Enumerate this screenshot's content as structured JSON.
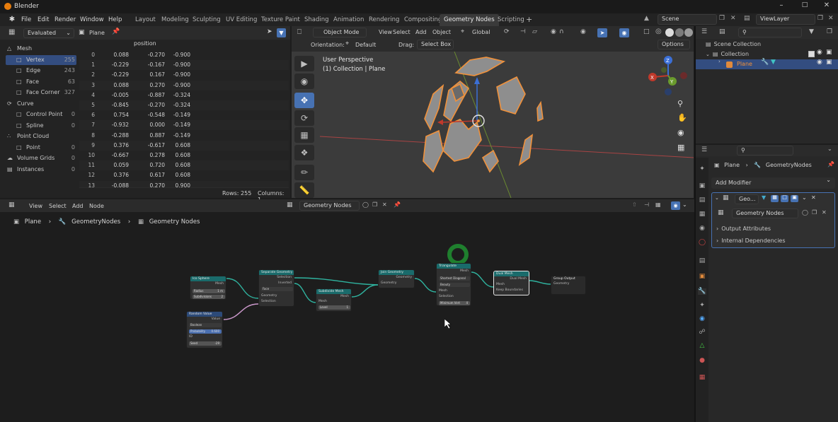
{
  "app": {
    "title": "Blender"
  },
  "menus": [
    "File",
    "Edit",
    "Render",
    "Window",
    "Help"
  ],
  "workspaces": [
    "Layout",
    "Modeling",
    "Sculpting",
    "UV Editing",
    "Texture Paint",
    "Shading",
    "Animation",
    "Rendering",
    "Compositing",
    "Geometry Nodes",
    "Scripting"
  ],
  "active_workspace": "Geometry Nodes",
  "scene": {
    "scene_name": "Scene",
    "view_layer": "ViewLayer"
  },
  "spreadsheet": {
    "mode": "Evaluated",
    "object": "Plane",
    "column_header": "position",
    "sidebar": [
      {
        "label": "Mesh",
        "count": "",
        "kind": "group"
      },
      {
        "label": "Vertex",
        "count": "255",
        "kind": "item",
        "active": true
      },
      {
        "label": "Edge",
        "count": "243",
        "kind": "item"
      },
      {
        "label": "Face",
        "count": "63",
        "kind": "item"
      },
      {
        "label": "Face Corner",
        "count": "327",
        "kind": "item"
      },
      {
        "label": "Curve",
        "count": "",
        "kind": "group"
      },
      {
        "label": "Control Point",
        "count": "0",
        "kind": "item"
      },
      {
        "label": "Spline",
        "count": "0",
        "kind": "item"
      },
      {
        "label": "Point Cloud",
        "count": "",
        "kind": "group"
      },
      {
        "label": "Point",
        "count": "0",
        "kind": "item"
      },
      {
        "label": "Volume Grids",
        "count": "0",
        "kind": "group"
      },
      {
        "label": "Instances",
        "count": "0",
        "kind": "group"
      }
    ],
    "rows": [
      [
        "0",
        "0.088",
        "-0.270",
        "-0.900"
      ],
      [
        "1",
        "-0.229",
        "-0.167",
        "-0.900"
      ],
      [
        "2",
        "-0.229",
        "0.167",
        "-0.900"
      ],
      [
        "3",
        "0.088",
        "0.270",
        "-0.900"
      ],
      [
        "4",
        "-0.005",
        "-0.887",
        "-0.324"
      ],
      [
        "5",
        "-0.845",
        "-0.270",
        "-0.324"
      ],
      [
        "6",
        "0.754",
        "-0.548",
        "-0.149"
      ],
      [
        "7",
        "-0.932",
        "0.000",
        "-0.149"
      ],
      [
        "8",
        "-0.288",
        "0.887",
        "-0.149"
      ],
      [
        "9",
        "0.376",
        "-0.617",
        "0.608"
      ],
      [
        "10",
        "-0.667",
        "0.278",
        "0.608"
      ],
      [
        "11",
        "0.059",
        "0.720",
        "0.608"
      ],
      [
        "12",
        "0.376",
        "0.617",
        "0.608"
      ],
      [
        "13",
        "-0.088",
        "0.270",
        "0.900"
      ]
    ],
    "footer": {
      "rows": "Rows: 255",
      "columns": "Columns: 1"
    }
  },
  "viewport": {
    "mode": "Object Mode",
    "menus": [
      "View",
      "Select",
      "Add",
      "Object"
    ],
    "transform": "Global",
    "orientation_label": "Orientation:",
    "orientation": "Default",
    "drag_label": "Drag:",
    "drag": "Select Box",
    "options": "Options",
    "overlay_title": "User Perspective",
    "overlay_sub": "(1) Collection | Plane",
    "gizmo": {
      "x": "X",
      "y": "Y",
      "z": "Z"
    }
  },
  "outliner": {
    "items": [
      {
        "label": "Scene Collection"
      },
      {
        "label": "Collection"
      },
      {
        "label": "Plane"
      }
    ]
  },
  "properties": {
    "breadcrumb": [
      "Plane",
      "GeometryNodes"
    ],
    "add_modifier": "Add Modifier",
    "modifier_short": "Geo...",
    "node_group": "Geometry Nodes",
    "panels": [
      "Output Attributes",
      "Internal Dependencies"
    ]
  },
  "node_editor": {
    "menus": [
      "View",
      "Select",
      "Add",
      "Node"
    ],
    "tree_name": "Geometry Nodes",
    "breadcrumb": [
      "Plane",
      "GeometryNodes",
      "Geometry Nodes"
    ],
    "nodes": {
      "ico": {
        "title": "Ico Sphere",
        "out": "Mesh",
        "f1": "Radius",
        "v1": "1 m",
        "f2": "Subdivisions",
        "v2": "2"
      },
      "rand": {
        "title": "Random Value",
        "out": "Value",
        "f1": "Boolean",
        "f2": "Probability",
        "v2": "0.600",
        "f3": "ID",
        "f4": "Seed",
        "v4": "-29"
      },
      "sep": {
        "title": "Separate Geometry",
        "o1": "Selection",
        "o2": "Inverted",
        "f1": "Face",
        "f2": "Geometry",
        "f3": "Selection"
      },
      "sub": {
        "title": "Subdivide Mesh",
        "out": "Mesh",
        "f1": "Mesh",
        "f2": "Level",
        "v2": "1"
      },
      "join": {
        "title": "Join Geometry",
        "out": "Geometry",
        "f1": "Geometry"
      },
      "tri": {
        "title": "Triangulate",
        "out": "Mesh",
        "f1": "Shortest Diagonal",
        "f2": "Beauty",
        "f3": "Mesh",
        "f4": "Selection",
        "f5": "Minimum Vert",
        "v5": "4"
      },
      "dual": {
        "title": "Dual Mesh",
        "out": "Dual Mesh",
        "f1": "Mesh",
        "f2": "Keep Boundaries"
      },
      "gout": {
        "title": "Group Output",
        "f1": "Geometry"
      }
    }
  },
  "colors": {
    "accent": "#4772b3",
    "selection_orange": "#f0913b"
  }
}
